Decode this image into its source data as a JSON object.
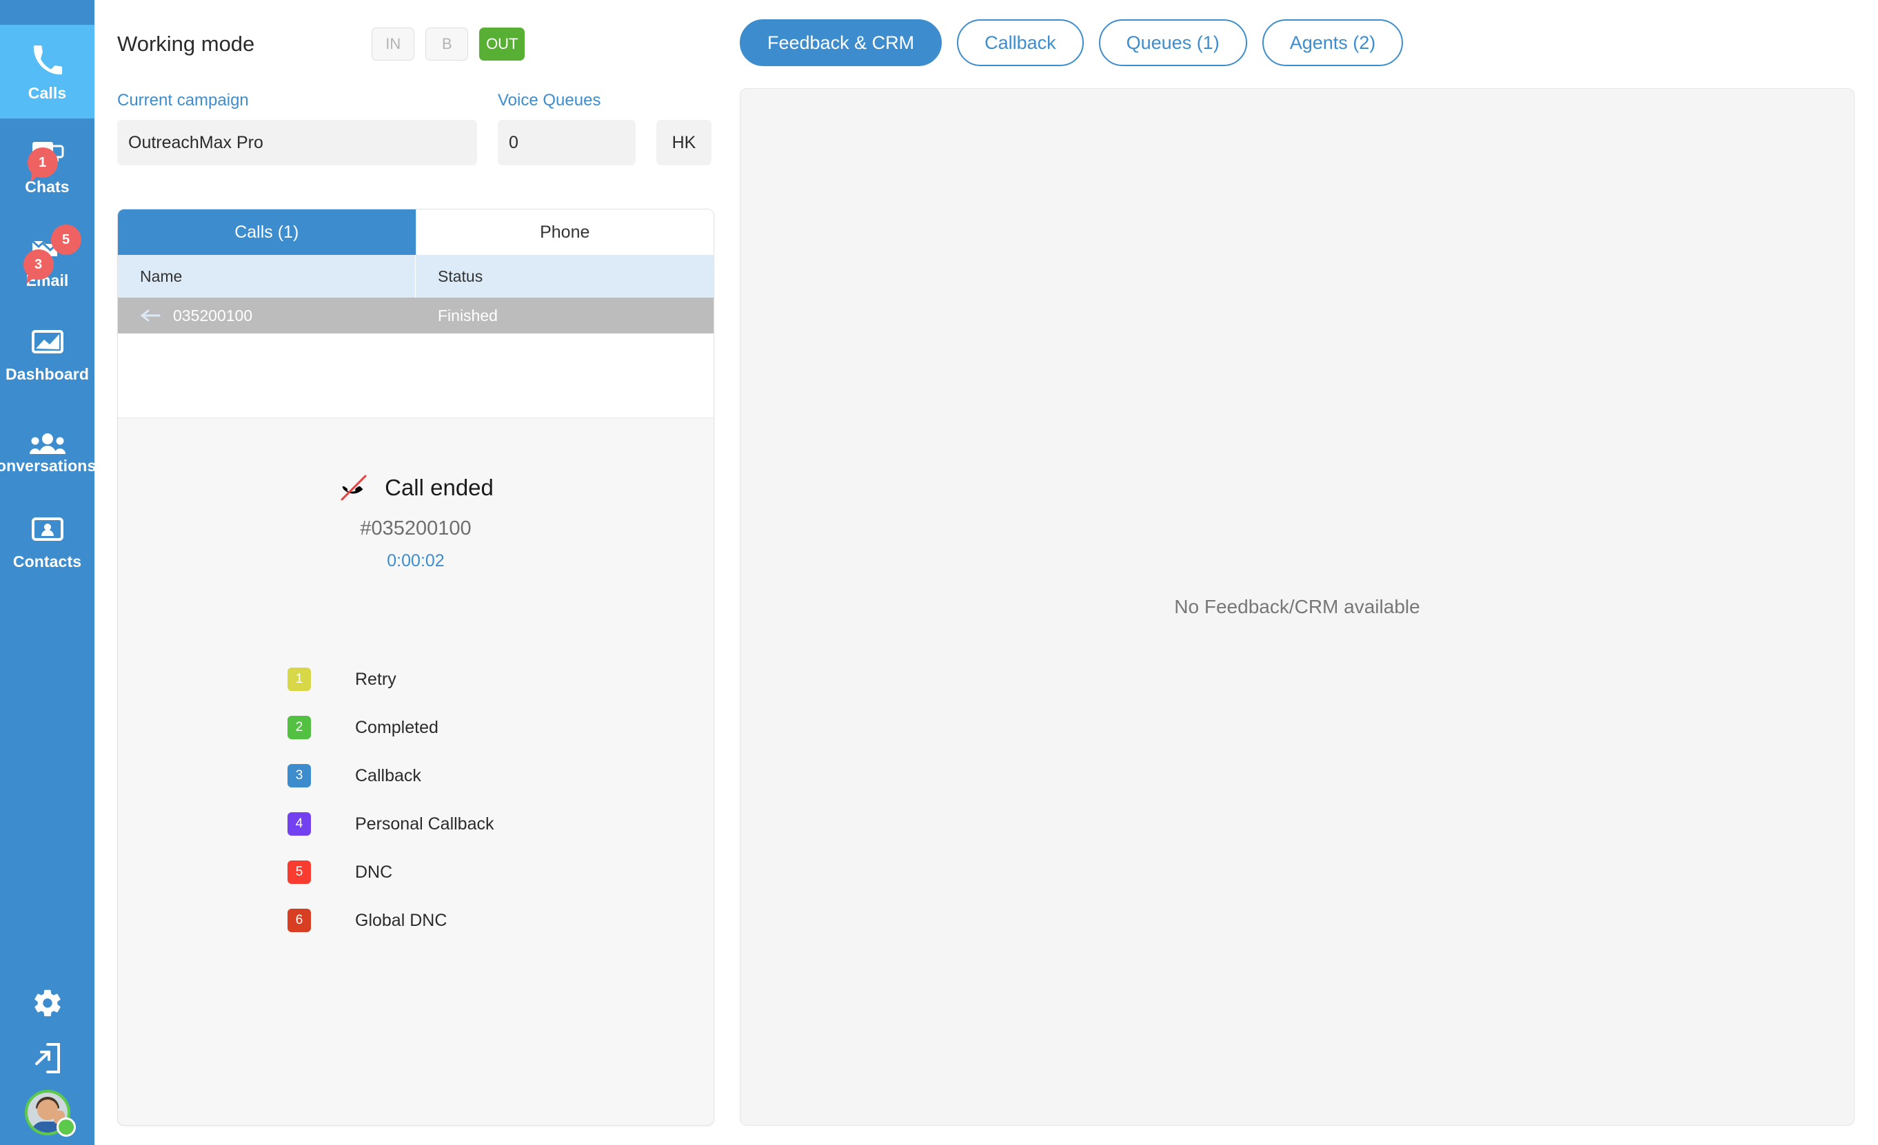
{
  "sidebar": {
    "items": [
      {
        "label": "Calls",
        "icon": "phone-icon",
        "active": true,
        "badges": []
      },
      {
        "label": "Chats",
        "icon": "chat-bubble-icon",
        "active": false,
        "badges": [
          "1"
        ]
      },
      {
        "label": "Email",
        "icon": "email-icon",
        "active": false,
        "badges": [
          "3",
          "5"
        ]
      },
      {
        "label": "Dashboard",
        "icon": "dashboard-icon",
        "active": false,
        "badges": []
      },
      {
        "label": "Conversations a",
        "icon": "people-icon",
        "active": false,
        "badges": []
      },
      {
        "label": "Contacts",
        "icon": "contact-card-icon",
        "active": false,
        "badges": []
      }
    ],
    "bottom": {
      "settings_icon": "gear-icon",
      "logout_icon": "logout-icon",
      "avatar": "user-avatar",
      "status": "available"
    }
  },
  "workbar": {
    "title": "Working mode",
    "modes": [
      {
        "label": "IN",
        "active": false
      },
      {
        "label": "B",
        "active": false
      },
      {
        "label": "OUT",
        "active": true
      }
    ]
  },
  "fields": {
    "campaign_label": "Current campaign",
    "campaign_value": "OutreachMax Pro",
    "queues_label": "Voice Queues",
    "queues_value": "0",
    "hk_label": "HK"
  },
  "call_panel": {
    "tabs": [
      {
        "label": "Calls (1)",
        "active": true
      },
      {
        "label": "Phone",
        "active": false
      }
    ],
    "columns": [
      "Name",
      "Status"
    ],
    "rows": [
      {
        "name": "035200100",
        "status": "Finished",
        "direction_icon": "arrow-left-icon"
      }
    ],
    "state": {
      "title": "Call ended",
      "icon": "phone-hangup-icon",
      "number": "#035200100",
      "duration": "0:00:02"
    },
    "dispositions": [
      {
        "key": "1",
        "label": "Retry",
        "color": "#d8d747"
      },
      {
        "key": "2",
        "label": "Completed",
        "color": "#52c040"
      },
      {
        "key": "3",
        "label": "Callback",
        "color": "#3d8dce"
      },
      {
        "key": "4",
        "label": "Personal Callback",
        "color": "#7341ef"
      },
      {
        "key": "5",
        "label": "DNC",
        "color": "#f93c30"
      },
      {
        "key": "6",
        "label": "Global DNC",
        "color": "#d73e22"
      }
    ]
  },
  "right_panel": {
    "tabs": [
      {
        "label": "Feedback & CRM",
        "active": true
      },
      {
        "label": "Callback",
        "active": false
      },
      {
        "label": "Queues (1)",
        "active": false
      },
      {
        "label": "Agents (2)",
        "active": false
      }
    ],
    "empty_message": "No Feedback/CRM available"
  },
  "colors": {
    "sidebar_bg": "#3d8dce",
    "sidebar_active": "#55bcf6",
    "accent": "#3d8dce",
    "badge_red": "#ef6262",
    "out_green": "#57b033"
  }
}
